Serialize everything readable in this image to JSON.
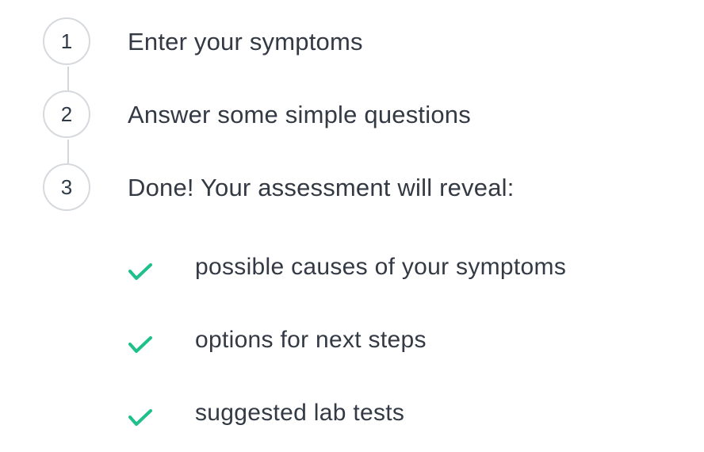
{
  "steps": [
    {
      "number": "1",
      "label": "Enter your symptoms"
    },
    {
      "number": "2",
      "label": "Answer some simple questions"
    },
    {
      "number": "3",
      "label": "Done! Your assessment will reveal:"
    }
  ],
  "benefits": [
    {
      "icon": "check-icon",
      "label": "possible causes of your symptoms"
    },
    {
      "icon": "check-icon",
      "label": "options for next steps"
    },
    {
      "icon": "check-icon",
      "label": "suggested lab tests"
    }
  ],
  "colors": {
    "accent": "#1fc08c",
    "text": "#333a44",
    "circle_border": "#d6d9dd"
  }
}
